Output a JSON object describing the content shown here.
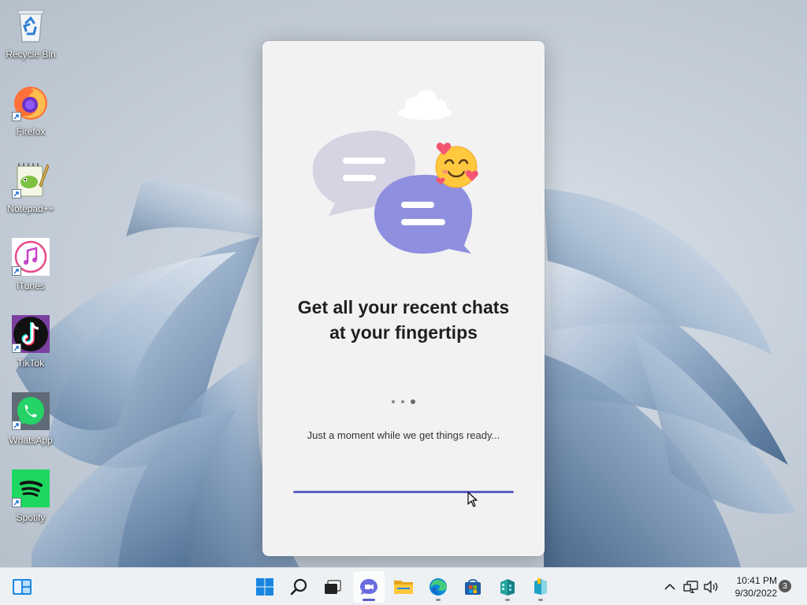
{
  "desktop": {
    "icons": [
      {
        "label": "Recycle Bin",
        "icon": "recycle-bin-icon"
      },
      {
        "label": "Firefox",
        "icon": "firefox-icon"
      },
      {
        "label": "Notepad++",
        "icon": "notepad-plus-plus-icon"
      },
      {
        "label": "iTunes",
        "icon": "itunes-icon"
      },
      {
        "label": "TikTok",
        "icon": "tiktok-icon"
      },
      {
        "label": "WhatsApp",
        "icon": "whatsapp-icon"
      },
      {
        "label": "Spotify",
        "icon": "spotify-icon"
      }
    ]
  },
  "dialog": {
    "heading_line1": "Get all your recent chats",
    "heading_line2": "at your fingertips",
    "status": "Just a moment while we get things ready...",
    "progress": 1.0,
    "accent": "#5b5fc7"
  },
  "taskbar": {
    "apps": [
      {
        "icon": "start-icon",
        "name": "Start"
      },
      {
        "icon": "search-icon",
        "name": "Search"
      },
      {
        "icon": "task-view-icon",
        "name": "Task View"
      },
      {
        "icon": "teams-chat-icon",
        "name": "Chat"
      },
      {
        "icon": "file-explorer-icon",
        "name": "File Explorer"
      },
      {
        "icon": "edge-icon",
        "name": "Microsoft Edge"
      },
      {
        "icon": "microsoft-store-icon",
        "name": "Microsoft Store"
      },
      {
        "icon": "app-icon",
        "name": "App"
      },
      {
        "icon": "app-icon",
        "name": "App"
      }
    ],
    "time": "10:41 PM",
    "date": "9/30/2022",
    "notification_count": "3"
  }
}
